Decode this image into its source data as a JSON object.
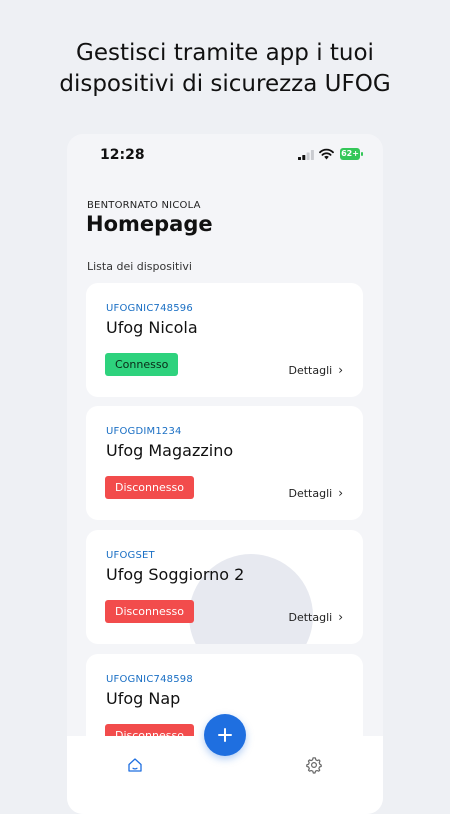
{
  "headline": {
    "line1": "Gestisci tramite app i tuoi",
    "line2": "dispositivi di sicurezza UFOG"
  },
  "status_bar": {
    "time": "12:28",
    "battery": "62+"
  },
  "header": {
    "welcome": "BENTORNATO NICOLA",
    "title": "Homepage"
  },
  "devices_section": {
    "label": "Lista dei dispositivi",
    "details_label": "Dettagli",
    "devices": [
      {
        "code": "UFOGNIC748596",
        "name": "Ufog Nicola",
        "status": "Connesso"
      },
      {
        "code": "UFOGDIM1234",
        "name": "Ufog Magazzino",
        "status": "Disconnesso"
      },
      {
        "code": "UFOGSET",
        "name": "Ufog Soggiorno 2",
        "status": "Disconnesso"
      },
      {
        "code": "UFOGNIC748598",
        "name": "Ufog Nap",
        "status": "Disconnesso"
      }
    ]
  },
  "nav": {
    "home_icon": "home-icon",
    "settings_icon": "gear-icon",
    "add_icon": "plus-icon"
  },
  "colors": {
    "connected": "#2ed27d",
    "disconnected": "#f24c4c",
    "accent": "#1f6fe0",
    "code": "#1a6fc4"
  }
}
